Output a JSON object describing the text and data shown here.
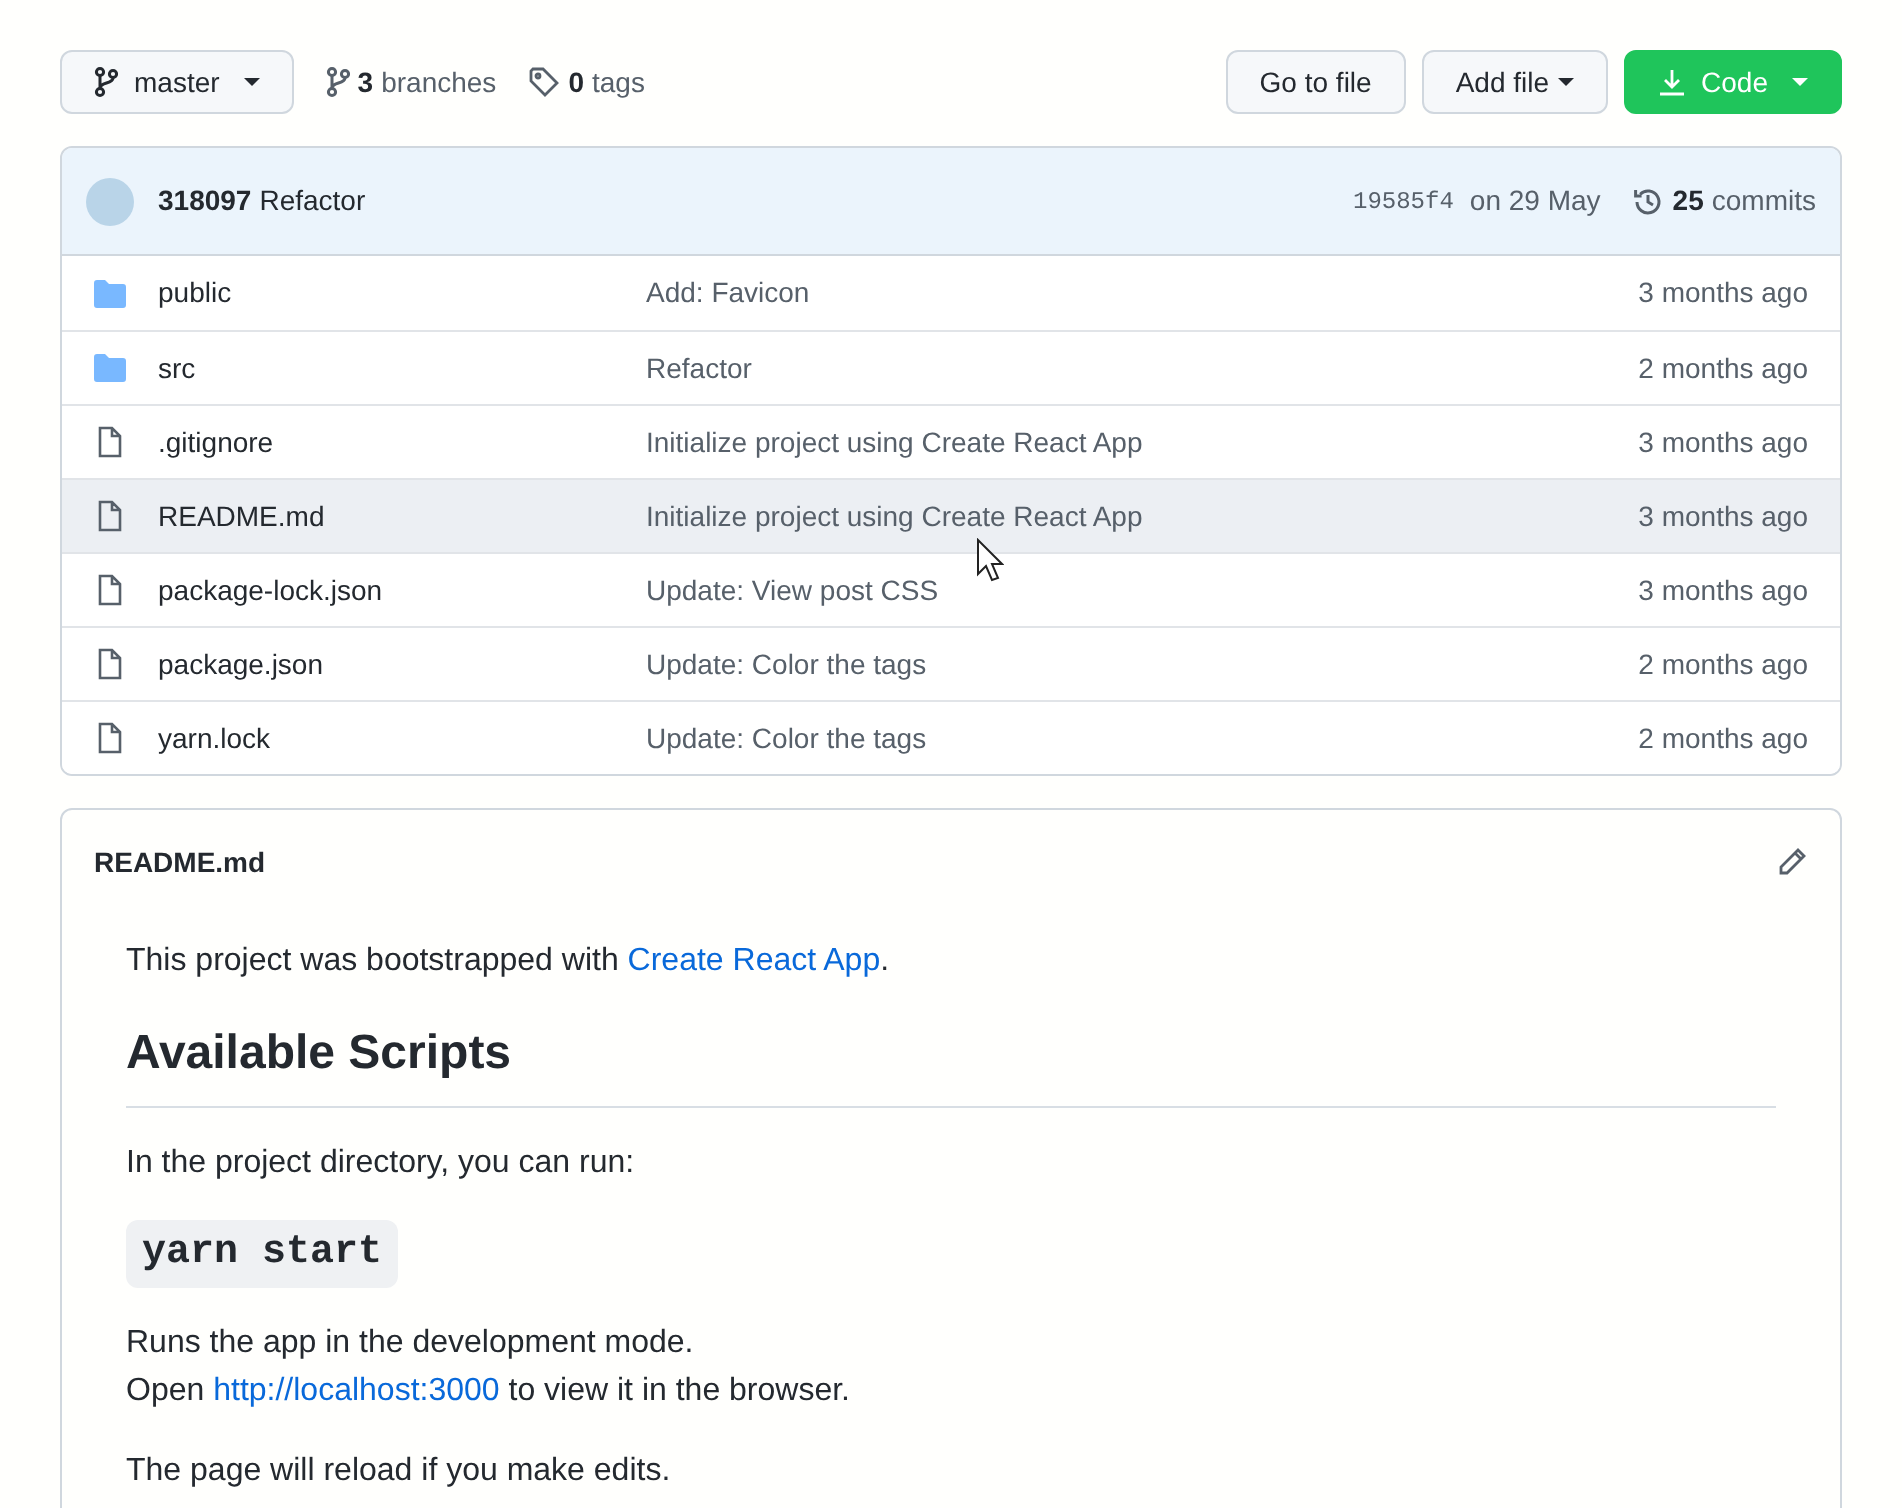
{
  "toolbar": {
    "branch": "master",
    "branches": {
      "count": "3",
      "label": "branches"
    },
    "tags": {
      "count": "0",
      "label": "tags"
    },
    "buttons": [
      {
        "label": "Go to file",
        "kind": "plain"
      },
      {
        "label": "Add file",
        "kind": "menu"
      },
      {
        "label": "Code",
        "kind": "primary"
      }
    ]
  },
  "commit": {
    "hash_author": "318097",
    "message": "Refactor",
    "sha": "19585f4",
    "date": "on 29 May",
    "commits": {
      "count": "25",
      "label": "commits"
    }
  },
  "files": [
    {
      "name": "public",
      "kind": "folder",
      "message": "Add: Favicon",
      "age": "3 months ago",
      "hovered": false
    },
    {
      "name": "src",
      "kind": "folder",
      "message": "Refactor",
      "age": "2 months ago",
      "hovered": false
    },
    {
      "name": ".gitignore",
      "kind": "file",
      "message": "Initialize project using Create React App",
      "age": "3 months ago",
      "hovered": false
    },
    {
      "name": "README.md",
      "kind": "file",
      "message": "Initialize project using Create React App",
      "age": "3 months ago",
      "hovered": true
    },
    {
      "name": "package-lock.json",
      "kind": "file",
      "message": "Update: View post CSS",
      "age": "3 months ago",
      "hovered": false
    },
    {
      "name": "package.json",
      "kind": "file",
      "message": "Update: Color the tags",
      "age": "2 months ago",
      "hovered": false
    },
    {
      "name": "yarn.lock",
      "kind": "file",
      "message": "Update: Color the tags",
      "age": "2 months ago",
      "hovered": false
    }
  ],
  "readme": {
    "title": "README.md",
    "blocks": [
      {
        "kind": "paragraph",
        "lines": [
          {
            "before": "This project was bootstrapped with ",
            "link": "Create React App",
            "after": "."
          }
        ]
      },
      {
        "kind": "heading",
        "text": "Available Scripts"
      },
      {
        "kind": "paragraph",
        "lines": [
          {
            "before": "In the project directory, you can run:"
          }
        ]
      },
      {
        "kind": "code",
        "text": "yarn start"
      },
      {
        "kind": "paragraph",
        "lines": [
          {
            "before": "Runs the app in the development mode."
          },
          {
            "before": "Open ",
            "link": "http://localhost:3000",
            "after": " to view it in the browser."
          }
        ]
      },
      {
        "kind": "paragraph",
        "lines": [
          {
            "before": "The page will reload if you make edits."
          }
        ]
      }
    ]
  }
}
